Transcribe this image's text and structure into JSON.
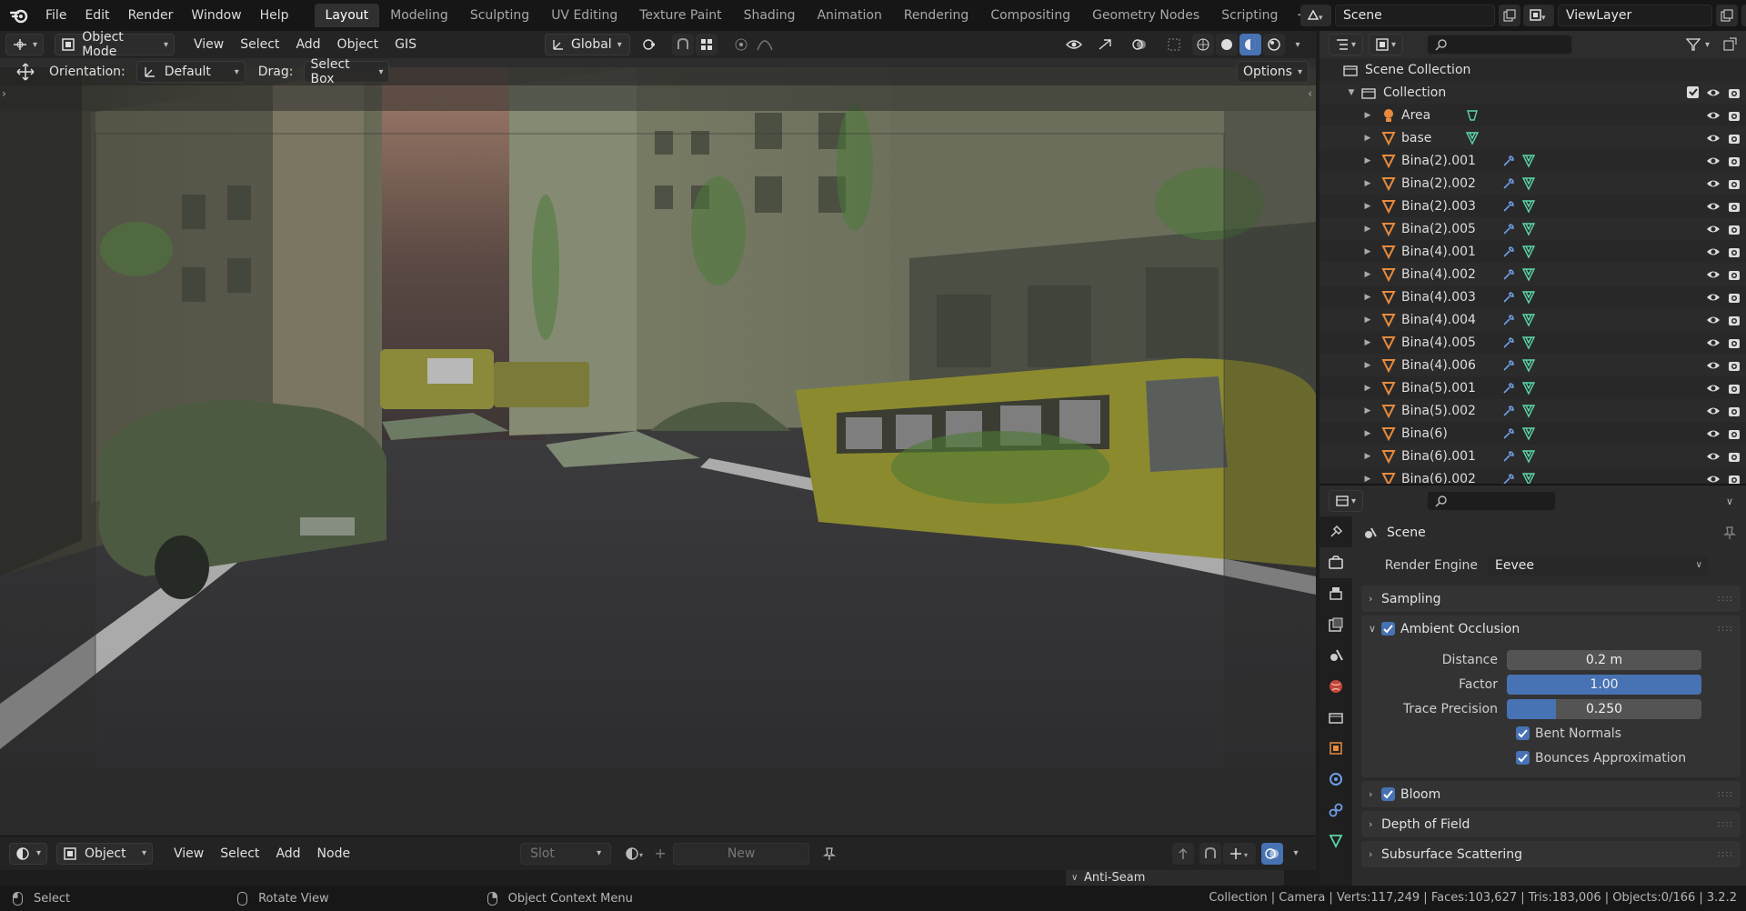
{
  "topbar": {
    "menu": [
      "File",
      "Edit",
      "Render",
      "Window",
      "Help"
    ],
    "workspaces": [
      "Layout",
      "Modeling",
      "Sculpting",
      "UV Editing",
      "Texture Paint",
      "Shading",
      "Animation",
      "Rendering",
      "Compositing",
      "Geometry Nodes",
      "Scripting"
    ],
    "active_workspace": "Layout",
    "scene": "Scene",
    "view_layer": "ViewLayer"
  },
  "viewport": {
    "header": {
      "mode": "Object Mode",
      "menus": [
        "View",
        "Select",
        "Add",
        "Object",
        "GIS"
      ],
      "transform_orientation": "Global"
    },
    "tool_settings": {
      "orientation_label": "Orientation:",
      "orientation_value": "Default",
      "drag_label": "Drag:",
      "drag_value": "Select Box",
      "options_label": "Options"
    }
  },
  "shader_editor": {
    "type": "Object",
    "menus": [
      "View",
      "Select",
      "Add",
      "Node"
    ],
    "slot": "Slot",
    "new_label": "New",
    "sidebar_panel": "Anti-Seam"
  },
  "statusbar": {
    "select": "Select",
    "rotate": "Rotate View",
    "context": "Object Context Menu",
    "stats": "Collection | Camera | Verts:117,249 | Faces:103,627 | Tris:183,006 | Objects:0/166 | 3.2.2"
  },
  "outliner": {
    "root": "Scene Collection",
    "collection": "Collection",
    "items": [
      {
        "name": "Area",
        "kind": "light"
      },
      {
        "name": "base",
        "kind": "mesh"
      },
      {
        "name": "Bina(2).001",
        "kind": "mesh-mod"
      },
      {
        "name": "Bina(2).002",
        "kind": "mesh-mod"
      },
      {
        "name": "Bina(2).003",
        "kind": "mesh-mod"
      },
      {
        "name": "Bina(2).005",
        "kind": "mesh-mod"
      },
      {
        "name": "Bina(4).001",
        "kind": "mesh-mod"
      },
      {
        "name": "Bina(4).002",
        "kind": "mesh-mod"
      },
      {
        "name": "Bina(4).003",
        "kind": "mesh-mod"
      },
      {
        "name": "Bina(4).004",
        "kind": "mesh-mod"
      },
      {
        "name": "Bina(4).005",
        "kind": "mesh-mod"
      },
      {
        "name": "Bina(4).006",
        "kind": "mesh-mod"
      },
      {
        "name": "Bina(5).001",
        "kind": "mesh-mod"
      },
      {
        "name": "Bina(5).002",
        "kind": "mesh-mod"
      },
      {
        "name": "Bina(6)",
        "kind": "mesh-mod"
      },
      {
        "name": "Bina(6).001",
        "kind": "mesh-mod"
      },
      {
        "name": "Bina(6).002",
        "kind": "mesh-mod"
      }
    ]
  },
  "properties": {
    "context": "Scene",
    "render_engine_label": "Render Engine",
    "render_engine": "Eevee",
    "panels": {
      "sampling": "Sampling",
      "ao": "Ambient Occlusion",
      "bloom": "Bloom",
      "dof": "Depth of Field",
      "sss": "Subsurface Scattering"
    },
    "ao": {
      "distance_label": "Distance",
      "distance": "0.2 m",
      "factor_label": "Factor",
      "factor": "1.00",
      "factor_fill": 1.0,
      "trace_label": "Trace Precision",
      "trace": "0.250",
      "trace_fill": 0.25,
      "bent_normals": "Bent Normals",
      "bounces": "Bounces Approximation"
    }
  },
  "colors": {
    "accent": "#4772b3",
    "mesh_icon": "#e78a3d",
    "data_icon": "#5cd6a6",
    "modifier_icon": "#6f9ee6"
  }
}
